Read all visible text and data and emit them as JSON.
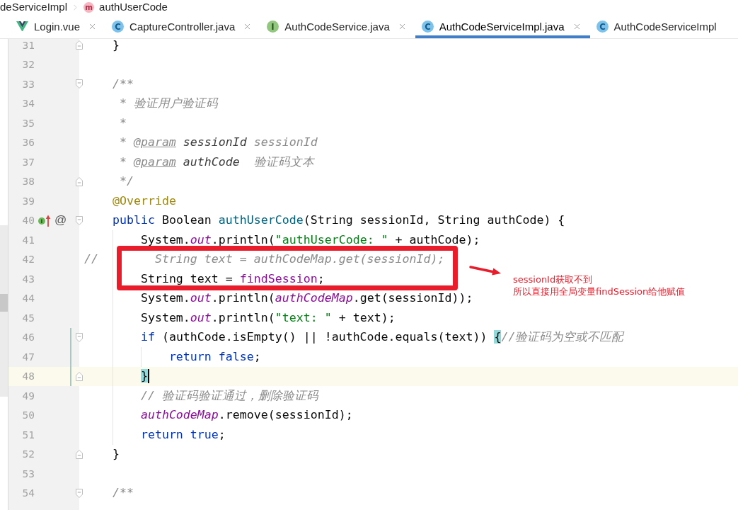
{
  "breadcrumb": [
    {
      "label": "deServiceImpl"
    },
    {
      "label": "authUserCode",
      "icon": {
        "kind": "method",
        "letter": "m"
      }
    }
  ],
  "tabs": [
    {
      "label": "Login.vue",
      "icon": {
        "kind": "vue"
      },
      "selected": false,
      "close_button": true
    },
    {
      "label": "CaptureController.java",
      "icon": {
        "kind": "class",
        "letter": "C"
      },
      "selected": false,
      "close_button": true
    },
    {
      "label": "AuthCodeService.java",
      "icon": {
        "kind": "interface",
        "letter": "I"
      },
      "selected": false,
      "close_button": true
    },
    {
      "label": "AuthCodeServiceImpl.java",
      "icon": {
        "kind": "class",
        "letter": "C"
      },
      "selected": true,
      "close_button": true
    },
    {
      "label": "AuthCodeServiceImpl",
      "icon": {
        "kind": "class",
        "letter": "C"
      },
      "selected": false,
      "close_button": false
    }
  ],
  "editor": {
    "lines": [
      {
        "number": "31",
        "changed": false,
        "current": false,
        "gutter_marks": [
          {
            "kind": "fold_end"
          }
        ],
        "tokens": [
          {
            "kind": "plain",
            "text": "    }"
          }
        ]
      },
      {
        "number": "32",
        "changed": false,
        "current": false
      },
      {
        "number": "33",
        "changed": false,
        "current": false,
        "gutter_marks": [
          {
            "kind": "fold_start"
          }
        ],
        "tokens": [
          {
            "kind": "doc",
            "text": "    /**"
          }
        ]
      },
      {
        "number": "34",
        "changed": false,
        "current": false,
        "tokens": [
          {
            "kind": "doc",
            "text": "     * 验证用户验证码"
          }
        ]
      },
      {
        "number": "35",
        "changed": false,
        "current": false,
        "tokens": [
          {
            "kind": "doc",
            "text": "     *"
          }
        ]
      },
      {
        "number": "36",
        "changed": false,
        "current": false,
        "tokens": [
          {
            "kind": "doc",
            "text": "     * "
          },
          {
            "kind": "doc_tag",
            "text": "@param"
          },
          {
            "kind": "doc_param",
            "text": " sessionId"
          },
          {
            "kind": "doc",
            "text": " sessionId"
          }
        ]
      },
      {
        "number": "37",
        "changed": false,
        "current": false,
        "tokens": [
          {
            "kind": "doc",
            "text": "     * "
          },
          {
            "kind": "doc_tag",
            "text": "@param"
          },
          {
            "kind": "doc_param",
            "text": " authCode"
          },
          {
            "kind": "doc",
            "text": "  验证码文本"
          }
        ]
      },
      {
        "number": "38",
        "changed": false,
        "current": false,
        "gutter_marks": [
          {
            "kind": "fold_end"
          }
        ],
        "tokens": [
          {
            "kind": "doc",
            "text": "     */"
          }
        ]
      },
      {
        "number": "39",
        "changed": false,
        "current": false,
        "tokens": [
          {
            "kind": "annotation",
            "text": "    @Override"
          }
        ]
      },
      {
        "number": "40",
        "changed": false,
        "current": false,
        "gutter_marks": [
          {
            "kind": "implements",
            "letter": "I"
          },
          {
            "kind": "symbol",
            "text": "@"
          },
          {
            "kind": "fold_start"
          }
        ],
        "tokens": [
          {
            "kind": "keyword",
            "text": "    public"
          },
          {
            "kind": "plain",
            "text": " Boolean "
          },
          {
            "kind": "method",
            "text": "authUserCode"
          },
          {
            "kind": "plain",
            "text": "(String sessionId, String authCode) {"
          }
        ]
      },
      {
        "number": "41",
        "changed": false,
        "current": false,
        "tokens": [
          {
            "kind": "plain",
            "text": "        System."
          },
          {
            "kind": "static_field",
            "text": "out"
          },
          {
            "kind": "plain",
            "text": ".println("
          },
          {
            "kind": "string",
            "text": "\"authUserCode: \""
          },
          {
            "kind": "plain",
            "text": " + authCode);"
          }
        ]
      },
      {
        "number": "42",
        "changed": false,
        "current": false,
        "tokens": [
          {
            "kind": "comment",
            "text": "//        String text = authCodeMap.get(sessionId);"
          }
        ]
      },
      {
        "number": "43",
        "changed": false,
        "current": false,
        "tokens": [
          {
            "kind": "plain",
            "text": "        String text = "
          },
          {
            "kind": "field",
            "text": "findSession"
          },
          {
            "kind": "plain",
            "text": ";"
          }
        ]
      },
      {
        "number": "44",
        "changed": false,
        "current": false,
        "tokens": [
          {
            "kind": "plain",
            "text": "        System."
          },
          {
            "kind": "static_field",
            "text": "out"
          },
          {
            "kind": "plain",
            "text": ".println("
          },
          {
            "kind": "static_field",
            "text": "authCodeMap"
          },
          {
            "kind": "plain",
            "text": ".get(sessionId));"
          }
        ]
      },
      {
        "number": "45",
        "changed": false,
        "current": false,
        "tokens": [
          {
            "kind": "plain",
            "text": "        System."
          },
          {
            "kind": "static_field",
            "text": "out"
          },
          {
            "kind": "plain",
            "text": ".println("
          },
          {
            "kind": "string",
            "text": "\"text: \""
          },
          {
            "kind": "plain",
            "text": " + text);"
          }
        ]
      },
      {
        "number": "46",
        "changed": true,
        "current": false,
        "gutter_marks": [
          {
            "kind": "fold_start"
          }
        ],
        "tokens": [
          {
            "kind": "keyword",
            "text": "        if"
          },
          {
            "kind": "plain",
            "text": " (authCode.isEmpty() || !authCode.equals(text)) "
          },
          {
            "kind": "brace_match",
            "text": "{"
          },
          {
            "kind": "comment",
            "text": "//验证码为空或不匹配"
          }
        ]
      },
      {
        "number": "47",
        "changed": true,
        "current": false,
        "tokens": [
          {
            "kind": "keyword",
            "text": "            return "
          },
          {
            "kind": "keyword",
            "text": "false"
          },
          {
            "kind": "plain",
            "text": ";"
          }
        ]
      },
      {
        "number": "48",
        "changed": true,
        "current": true,
        "gutter_marks": [
          {
            "kind": "fold_end"
          }
        ],
        "tokens": [
          {
            "kind": "brace_match",
            "text": "        }"
          }
        ]
      },
      {
        "number": "49",
        "changed": false,
        "current": false,
        "tokens": [
          {
            "kind": "comment",
            "text": "        // 验证码验证通过，删除验证码"
          }
        ]
      },
      {
        "number": "50",
        "changed": false,
        "current": false,
        "tokens": [
          {
            "kind": "static_field",
            "text": "        authCodeMap"
          },
          {
            "kind": "plain",
            "text": ".remove(sessionId);"
          }
        ]
      },
      {
        "number": "51",
        "changed": false,
        "current": false,
        "tokens": [
          {
            "kind": "keyword",
            "text": "        return "
          },
          {
            "kind": "keyword",
            "text": "true"
          },
          {
            "kind": "plain",
            "text": ";"
          }
        ]
      },
      {
        "number": "52",
        "changed": false,
        "current": false,
        "gutter_marks": [
          {
            "kind": "fold_end"
          }
        ],
        "tokens": [
          {
            "kind": "plain",
            "text": "    }"
          }
        ]
      },
      {
        "number": "53",
        "changed": false,
        "current": false
      },
      {
        "number": "54",
        "changed": false,
        "current": false,
        "gutter_marks": [
          {
            "kind": "fold_start"
          }
        ],
        "tokens": [
          {
            "kind": "doc",
            "text": "    /**"
          }
        ]
      }
    ]
  },
  "annotation": {
    "note_lines": [
      "sessionId获取不到",
      "所以直接用全局变量findSession给他赋值"
    ]
  }
}
